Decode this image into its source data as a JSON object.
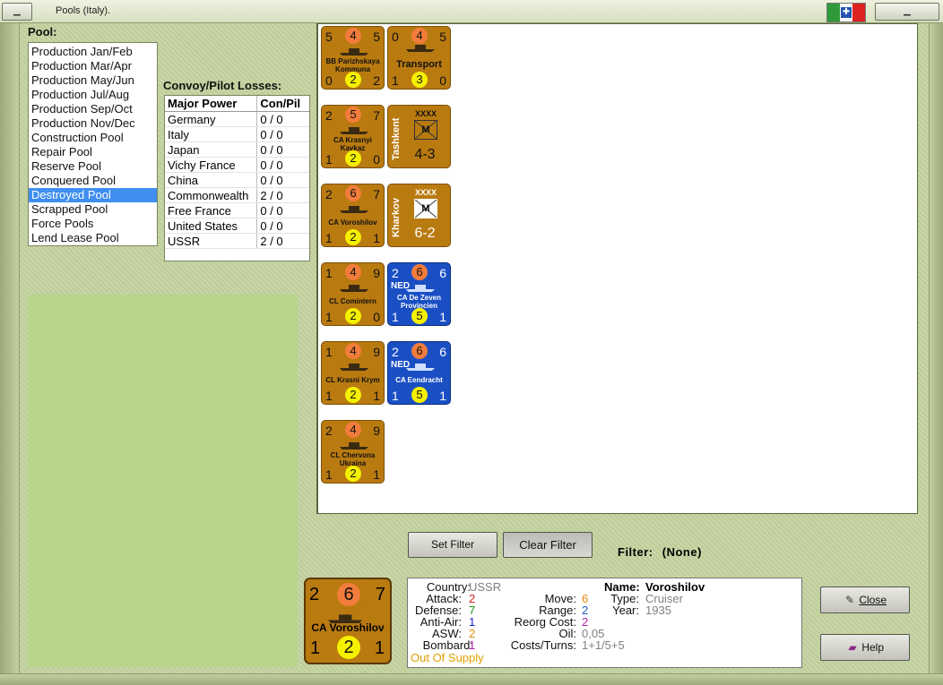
{
  "window": {
    "title": "Pools (Italy)."
  },
  "pool": {
    "label": "Pool:",
    "items": [
      "Production Jan/Feb",
      "Production Mar/Apr",
      "Production May/Jun",
      "Production Jul/Aug",
      "Production Sep/Oct",
      "Production Nov/Dec",
      "Construction Pool",
      "Repair Pool",
      "Reserve Pool",
      "Conquered Pool",
      "Destroyed Pool",
      "Scrapped Pool",
      "Force Pools",
      "Lend Lease Pool"
    ],
    "selected": "Destroyed Pool"
  },
  "losses": {
    "title": "Convoy/Pilot Losses:",
    "headers": [
      "Major Power",
      "Con/Pil"
    ],
    "rows": [
      {
        "power": "Germany",
        "value": "0 / 0"
      },
      {
        "power": "Italy",
        "value": "0 / 0"
      },
      {
        "power": "Japan",
        "value": "0 / 0"
      },
      {
        "power": "Vichy France",
        "value": "0 / 0"
      },
      {
        "power": "China",
        "value": "0 / 0"
      },
      {
        "power": "Commonwealth",
        "value": "2 / 0"
      },
      {
        "power": "Free France",
        "value": "0 / 0"
      },
      {
        "power": "United States",
        "value": "0 / 0"
      },
      {
        "power": "USSR",
        "value": "2 / 0"
      }
    ]
  },
  "units": [
    {
      "tl": "5",
      "top": "4",
      "tr": "5",
      "bl": "0",
      "bot": "2",
      "br": "2",
      "name": "BB Parizhskaya Kommuna"
    },
    {
      "tl": "0",
      "top": "4",
      "tr": "5",
      "bl": "1",
      "bot": "3",
      "br": "0",
      "name": "Transport"
    },
    {
      "tl": "2",
      "top": "5",
      "tr": "7",
      "bl": "1",
      "bot": "2",
      "br": "0",
      "name": "CA Krasnyi Kavkaz"
    },
    {
      "tl": "2",
      "top": "6",
      "tr": "7",
      "bl": "1",
      "bot": "2",
      "br": "1",
      "name": "CA Voroshilov"
    },
    {
      "tl": "1",
      "top": "4",
      "tr": "9",
      "bl": "1",
      "bot": "2",
      "br": "0",
      "name": "CL Comintern"
    },
    {
      "tl": "1",
      "top": "4",
      "tr": "9",
      "bl": "1",
      "bot": "2",
      "br": "1",
      "name": "CL Krasni Krym"
    },
    {
      "tl": "2",
      "top": "4",
      "tr": "9",
      "bl": "1",
      "bot": "2",
      "br": "1",
      "name": "CL Chervona Ukraina"
    },
    {
      "tl": "2",
      "top": "6",
      "tr": "6",
      "bl": "1",
      "bot": "5",
      "br": "1",
      "name": "CA De Zeven Provincien",
      "nation": "NED"
    },
    {
      "tl": "2",
      "top": "6",
      "tr": "6",
      "bl": "1",
      "bot": "5",
      "br": "1",
      "name": "CA Eendracht",
      "nation": "NED"
    }
  ],
  "armies": [
    {
      "name": "Tashkent",
      "size": "XXXX",
      "symbol": "M",
      "strength": "4-3"
    },
    {
      "name": "Kharkov",
      "size": "XXXX",
      "symbol": "M",
      "strength": "6-2"
    }
  ],
  "filter": {
    "set_label": "Set Filter",
    "clear_label": "Clear Filter",
    "label": "Filter:",
    "value": "(None)"
  },
  "selected_unit": {
    "tl": "2",
    "top": "6",
    "tr": "7",
    "bl": "1",
    "bot": "2",
    "br": "1",
    "name": "CA Voroshilov"
  },
  "details": {
    "country_label": "Country:",
    "country": "USSR",
    "attack_label": "Attack:",
    "attack": "2",
    "defense_label": "Defense:",
    "defense": "7",
    "antiair_label": "Anti-Air:",
    "antiair": "1",
    "asw_label": "ASW:",
    "asw": "2",
    "bombard_label": "Bombard:",
    "bombard": "1",
    "supply": "Out Of Supply",
    "move_label": "Move:",
    "move": "6",
    "range_label": "Range:",
    "range": "2",
    "reorg_label": "Reorg Cost:",
    "reorg": "2",
    "oil_label": "Oil:",
    "oil": "0,05",
    "costs_label": "Costs/Turns:",
    "costs": "1+1/5+5",
    "name_label": "Name:",
    "name": "Voroshilov",
    "type_label": "Type:",
    "type": "Cruiser",
    "year_label": "Year:",
    "year": "1935"
  },
  "buttons": {
    "close": "Close",
    "help": "Help"
  },
  "colors": {
    "soviet_counter": "#b97a10",
    "dutch_counter": "#1a4fc4",
    "selected_row": "#3f8ef0",
    "attack": "#d02020",
    "defense": "#209020",
    "antiair": "#2020d0",
    "asw": "#e08a10",
    "bombard": "#b020b0",
    "supply": "#e0a000"
  }
}
